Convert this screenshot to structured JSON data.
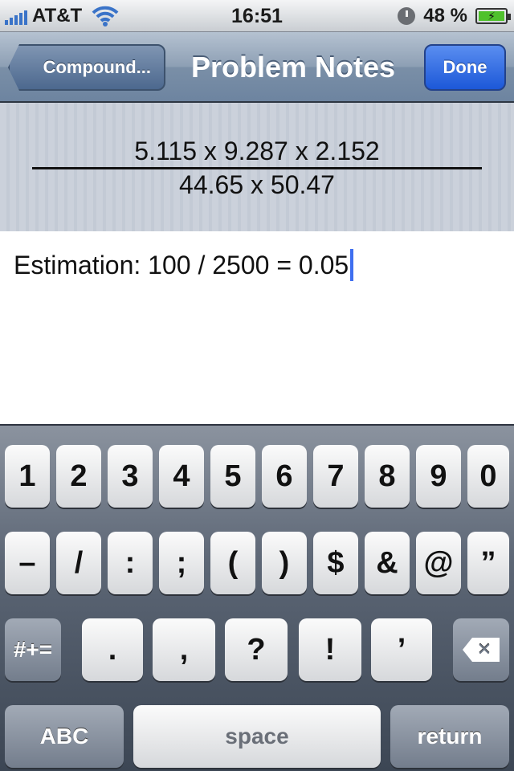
{
  "status_bar": {
    "carrier": "AT&T",
    "time": "16:51",
    "battery": "48 %"
  },
  "nav": {
    "back_label": "Compound...",
    "title": "Problem Notes",
    "done_label": "Done"
  },
  "problem": {
    "numerator": "5.115 x 9.287 x 2.152",
    "denominator": "44.65 x 50.47"
  },
  "notes": {
    "text": "Estimation: 100 / 2500 = 0.05"
  },
  "keyboard": {
    "row1": [
      "1",
      "2",
      "3",
      "4",
      "5",
      "6",
      "7",
      "8",
      "9",
      "0"
    ],
    "row2": [
      "–",
      "/",
      ":",
      ";",
      "(",
      ")",
      "$",
      "&",
      "@",
      "”"
    ],
    "row3": [
      ".",
      ",",
      "?",
      "!",
      "’"
    ],
    "mode_label": "#+=",
    "abc_label": "ABC",
    "space_label": "space",
    "return_label": "return"
  }
}
